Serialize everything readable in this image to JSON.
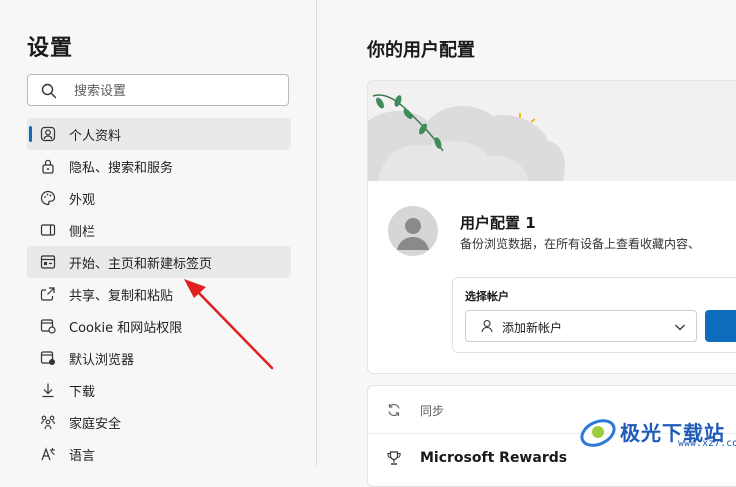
{
  "sidebar": {
    "title": "设置",
    "search_placeholder": "搜索设置",
    "items": [
      {
        "label": "个人资料",
        "icon": "profile-icon"
      },
      {
        "label": "隐私、搜索和服务",
        "icon": "lock-icon"
      },
      {
        "label": "外观",
        "icon": "palette-icon"
      },
      {
        "label": "侧栏",
        "icon": "sidebar-icon"
      },
      {
        "label": "开始、主页和新建标签页",
        "icon": "home-tab-icon"
      },
      {
        "label": "共享、复制和粘贴",
        "icon": "share-icon"
      },
      {
        "label": "Cookie 和网站权限",
        "icon": "cookie-icon"
      },
      {
        "label": "默认浏览器",
        "icon": "browser-icon"
      },
      {
        "label": "下载",
        "icon": "download-icon"
      },
      {
        "label": "家庭安全",
        "icon": "family-icon"
      },
      {
        "label": "语言",
        "icon": "language-icon"
      }
    ]
  },
  "main": {
    "title": "你的用户配置",
    "profile": {
      "name": "用户配置 1",
      "description": "备份浏览数据，在所有设备上查看收藏内容、"
    },
    "account": {
      "label": "选择帐户",
      "selected": "添加新帐户"
    },
    "rows": [
      {
        "label": "同步",
        "icon": "sync-icon"
      },
      {
        "label": "Microsoft Rewards",
        "icon": "trophy-icon"
      }
    ]
  },
  "watermark": {
    "text": "极光下载站",
    "url": "www.xz7.com"
  },
  "colors": {
    "accent": "#0f6cbd",
    "annotation_arrow": "#e02020"
  }
}
